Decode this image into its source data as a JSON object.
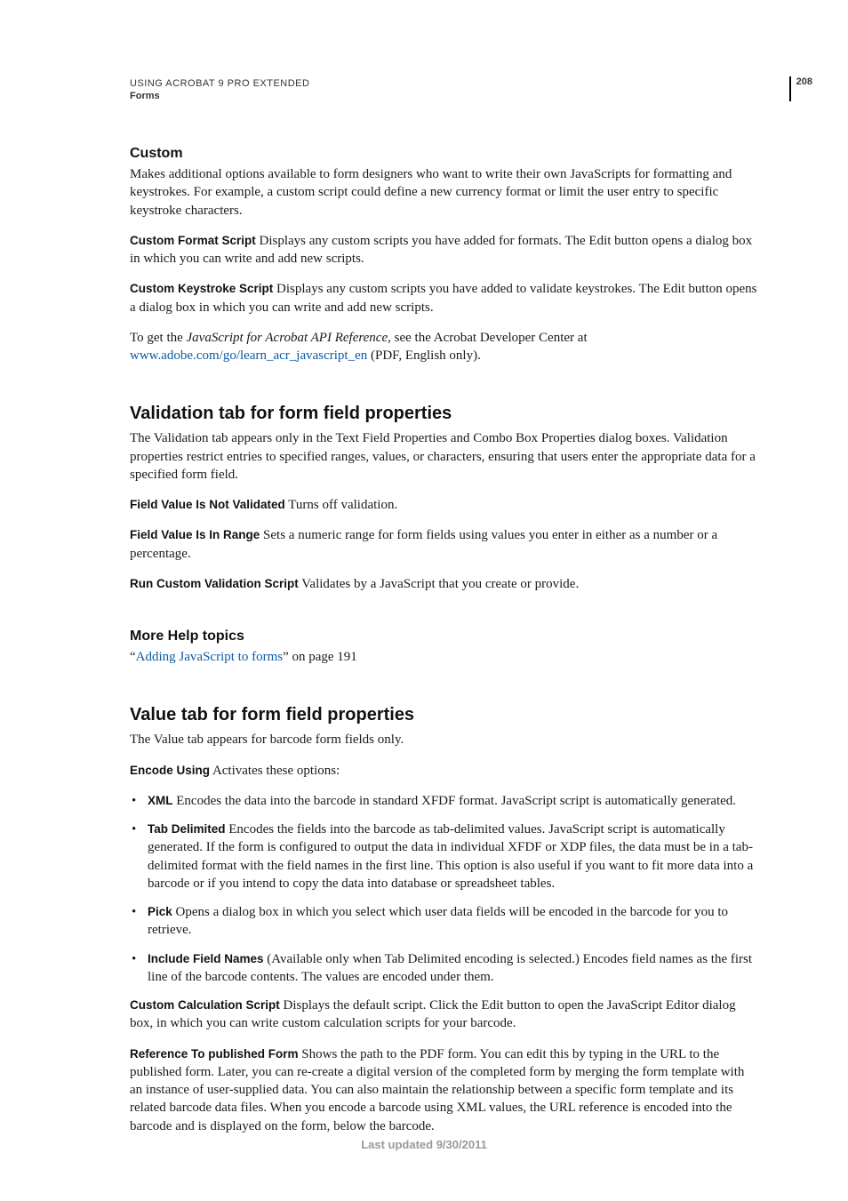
{
  "header": {
    "line1": "USING ACROBAT 9 PRO EXTENDED",
    "line2": "Forms",
    "page_num": "208"
  },
  "custom": {
    "heading": "Custom",
    "intro": "Makes additional options available to form designers who want to write their own JavaScripts for formatting and keystrokes. For example, a custom script could define a new currency format or limit the user entry to specific keystroke characters.",
    "fmt_term": "Custom Format Script",
    "fmt_body": "  Displays any custom scripts you have added for formats. The Edit button opens a dialog box in which you can write and add new scripts.",
    "key_term": "Custom Keystroke Script",
    "key_body": "  Displays any custom scripts you have added to validate keystrokes. The Edit button opens a dialog box in which you can write and add new scripts.",
    "api_pre": "To get the ",
    "api_italic": "JavaScript for Acrobat API Reference",
    "api_mid": ", see the Acrobat Developer Center at ",
    "api_link": "www.adobe.com/go/learn_acr_javascript_en",
    "api_post": " (PDF, English only)."
  },
  "validation": {
    "heading": "Validation tab for form field properties",
    "intro": "The Validation tab appears only in the Text Field Properties and Combo Box Properties dialog boxes. Validation properties restrict entries to specified ranges, values, or characters, ensuring that users enter the appropriate data for a specified form field.",
    "t1": "Field Value Is Not Validated",
    "t1b": "  Turns off validation.",
    "t2": "Field Value Is In Range",
    "t2b": "  Sets a numeric range for form fields using values you enter in either as a number or a percentage.",
    "t3": "Run Custom Validation Script",
    "t3b": "  Validates by a JavaScript that you create or provide."
  },
  "morehelp": {
    "heading": "More Help topics",
    "q1": "“",
    "link": "Adding JavaScript to forms",
    "q2": "” on page 191"
  },
  "value": {
    "heading": "Value tab for form field properties",
    "intro": "The Value tab appears for barcode form fields only.",
    "enc_term": "Encode Using",
    "enc_body": "  Activates these options:",
    "xml_term": "XML",
    "xml_body": "  Encodes the data into the barcode in standard XFDF format. JavaScript script is automatically generated.",
    "tab_term": "Tab Delimited",
    "tab_body": "  Encodes the fields into the barcode as tab-delimited values. JavaScript script is automatically generated. If the form is configured to output the data in individual XFDF or XDP files, the data must be in a tab-delimited format with the field names in the first line. This option is also useful if you want to fit more data into a barcode or if you intend to copy the data into database or spreadsheet tables.",
    "pick_term": "Pick",
    "pick_body": "   Opens a dialog box in which you select which user data fields will be encoded in the barcode for you to retrieve.",
    "inc_term": "Include Field Names",
    "inc_body": "   (Available only when Tab Delimited encoding is selected.) Encodes field names as the first line of the barcode contents. The values are encoded under them.",
    "ccs_term": "Custom Calculation Script",
    "ccs_body": "  Displays the default script. Click the Edit button to open the JavaScript Editor dialog box, in which you can write custom calculation scripts for your barcode.",
    "ref_term": "Reference To published Form",
    "ref_body": "   Shows the path to the PDF form. You can edit this by typing in the URL to the published form. Later, you can re-create a digital version of the completed form by merging the form template with an instance of user-supplied data. You can also maintain the relationship between a specific form template and its related barcode data files. When you encode a barcode using XML values, the URL reference is encoded into the barcode and is displayed on the form, below the barcode."
  },
  "footer": "Last updated 9/30/2011"
}
